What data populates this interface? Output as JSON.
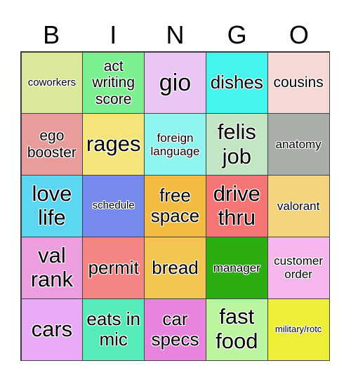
{
  "title_letters": [
    "B",
    "I",
    "N",
    "G",
    "O"
  ],
  "cells": [
    {
      "text": "coworkers",
      "color": "#dde89a"
    },
    {
      "text": "act writing score",
      "color": "#7cf090"
    },
    {
      "text": "gio",
      "color": "#e9c6f6"
    },
    {
      "text": "dishes",
      "color": "#44f5ee"
    },
    {
      "text": "cousins",
      "color": "#f6d8d7"
    },
    {
      "text": "ego booster",
      "color": "#ea9c9c"
    },
    {
      "text": "rages",
      "color": "#f3e57a"
    },
    {
      "text": "foreign language",
      "color": "#90f4ef"
    },
    {
      "text": "felis job",
      "color": "#c2e6c3"
    },
    {
      "text": "anatomy",
      "color": "#aaaea8"
    },
    {
      "text": "love life",
      "color": "#5bd7f2"
    },
    {
      "text": "schedule",
      "color": "#7589ee"
    },
    {
      "text": "free space",
      "color": "#f3bb40"
    },
    {
      "text": "drive thru",
      "color": "#f57474"
    },
    {
      "text": "valorant",
      "color": "#f4d47c"
    },
    {
      "text": "val rank",
      "color": "#ec9ee0"
    },
    {
      "text": "permit",
      "color": "#f58582"
    },
    {
      "text": "bread",
      "color": "#f3c653"
    },
    {
      "text": "manager",
      "color": "#2cad10"
    },
    {
      "text": "customer order",
      "color": "#f6b8ec"
    },
    {
      "text": "cars",
      "color": "#e9aaf6"
    },
    {
      "text": "eats in mic",
      "color": "#55ebbb"
    },
    {
      "text": "car specs",
      "color": "#e884de"
    },
    {
      "text": "fast food",
      "color": "#bcf5a0"
    },
    {
      "text": "military/rotc",
      "color": "#efee36"
    }
  ]
}
